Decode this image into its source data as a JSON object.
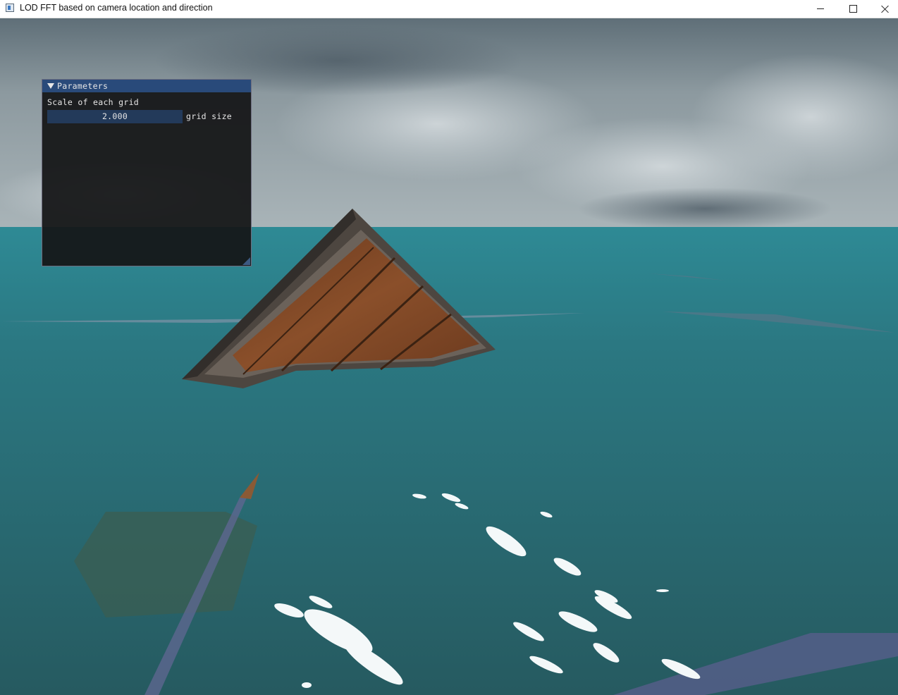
{
  "window": {
    "title": "LOD FFT based on camera location and direction",
    "controls": [
      "minimize",
      "maximize",
      "close"
    ]
  },
  "parameters_panel": {
    "title": "Parameters",
    "label": "Scale of each grid",
    "slider": {
      "value": "2.000",
      "label": "grid size"
    }
  },
  "colors": {
    "sky": "#8a979f",
    "ocean": "#2a5f68",
    "panel_header": "#294a7a",
    "slider_bg": "#233a5a"
  }
}
